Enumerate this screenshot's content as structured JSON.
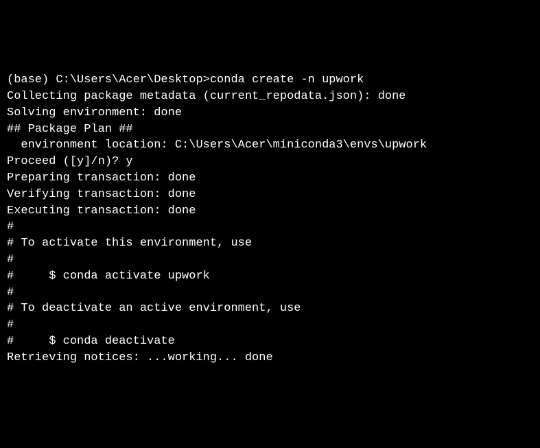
{
  "terminal": {
    "lines": [
      "(base) C:\\Users\\Acer\\Desktop>conda create -n upwork",
      "Collecting package metadata (current_repodata.json): done",
      "Solving environment: done",
      "",
      "## Package Plan ##",
      "",
      "  environment location: C:\\Users\\Acer\\miniconda3\\envs\\upwork",
      "",
      "",
      "",
      "Proceed ([y]/n)? y",
      "",
      "Preparing transaction: done",
      "Verifying transaction: done",
      "Executing transaction: done",
      "#",
      "# To activate this environment, use",
      "#",
      "#     $ conda activate upwork",
      "#",
      "# To deactivate an active environment, use",
      "#",
      "#     $ conda deactivate",
      "",
      "Retrieving notices: ...working... done"
    ]
  }
}
